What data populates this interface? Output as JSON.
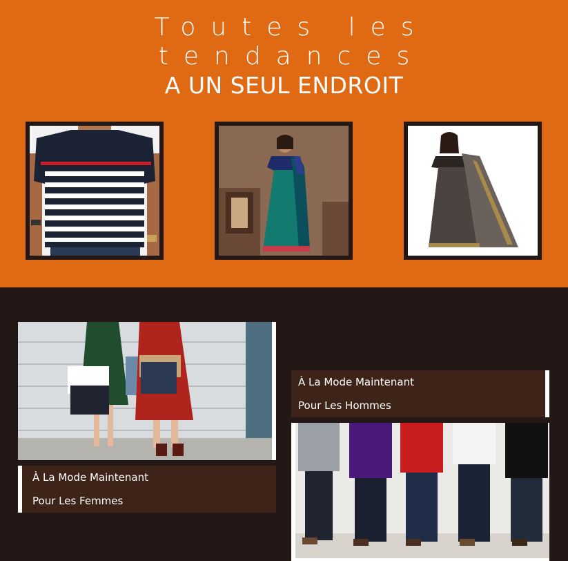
{
  "hero": {
    "line1": "Toutes les",
    "line2": "tendances",
    "line3": "A UN SEUL ENDROIT"
  },
  "products": [
    {
      "name": "striped-tshirt"
    },
    {
      "name": "teal-saree"
    },
    {
      "name": "dark-saree"
    }
  ],
  "women": {
    "caption_line1": "À La Mode Maintenant",
    "caption_line2": "Pour Les Femmes"
  },
  "men": {
    "caption_line1": "À La Mode Maintenant",
    "caption_line2": "Pour Les Hommes"
  },
  "colors": {
    "accent": "#e06a14",
    "dark": "#231815",
    "caption_bg": "#3e2418"
  }
}
